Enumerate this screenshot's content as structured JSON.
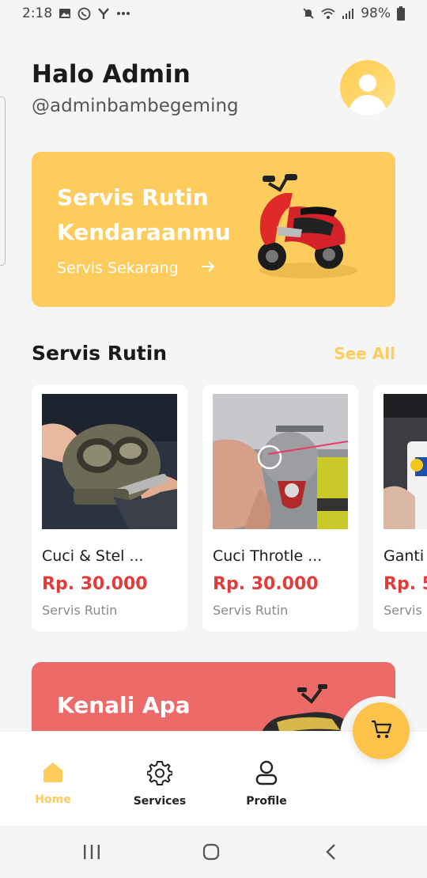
{
  "status_bar": {
    "time": "2:18",
    "left_icons": [
      "image-icon",
      "whatsapp-icon",
      "y-icon",
      "more-icon"
    ],
    "right_icons": [
      "mute-icon",
      "wifi-icon",
      "signal-icon",
      "battery-icon"
    ],
    "battery": "98%"
  },
  "header": {
    "greeting": "Halo Admin",
    "username": "@adminbambegeming",
    "avatar_icon": "user-icon"
  },
  "promo_banner": {
    "title": "Servis Rutin Kendaraanmu",
    "cta_label": "Servis Sekarang",
    "cta_icon": "arrow-right-icon",
    "bg_color": "#fecc5c"
  },
  "section": {
    "title": "Servis Rutin",
    "see_all": "See All"
  },
  "cards": [
    {
      "title": "Cuci & Stel ...",
      "price": "Rp. 30.000",
      "category": "Servis Rutin"
    },
    {
      "title": "Cuci Throtle ...",
      "price": "Rp. 30.000",
      "category": "Servis Rutin"
    },
    {
      "title": "Ganti",
      "price": "Rp. 5",
      "category": "Servis"
    }
  ],
  "promo_banner_2": {
    "title": "Kenali Apa",
    "bg_color": "#ec6a67"
  },
  "bottom_nav": {
    "items": [
      {
        "label": "Home",
        "icon": "home-icon",
        "active": true
      },
      {
        "label": "Services",
        "icon": "gear-icon",
        "active": false
      },
      {
        "label": "Profile",
        "icon": "profile-icon",
        "active": false
      }
    ],
    "fab_icon": "cart-icon"
  },
  "colors": {
    "accent": "#fecc5c",
    "price": "#e23b3b",
    "secondary_banner": "#ec6a67"
  }
}
